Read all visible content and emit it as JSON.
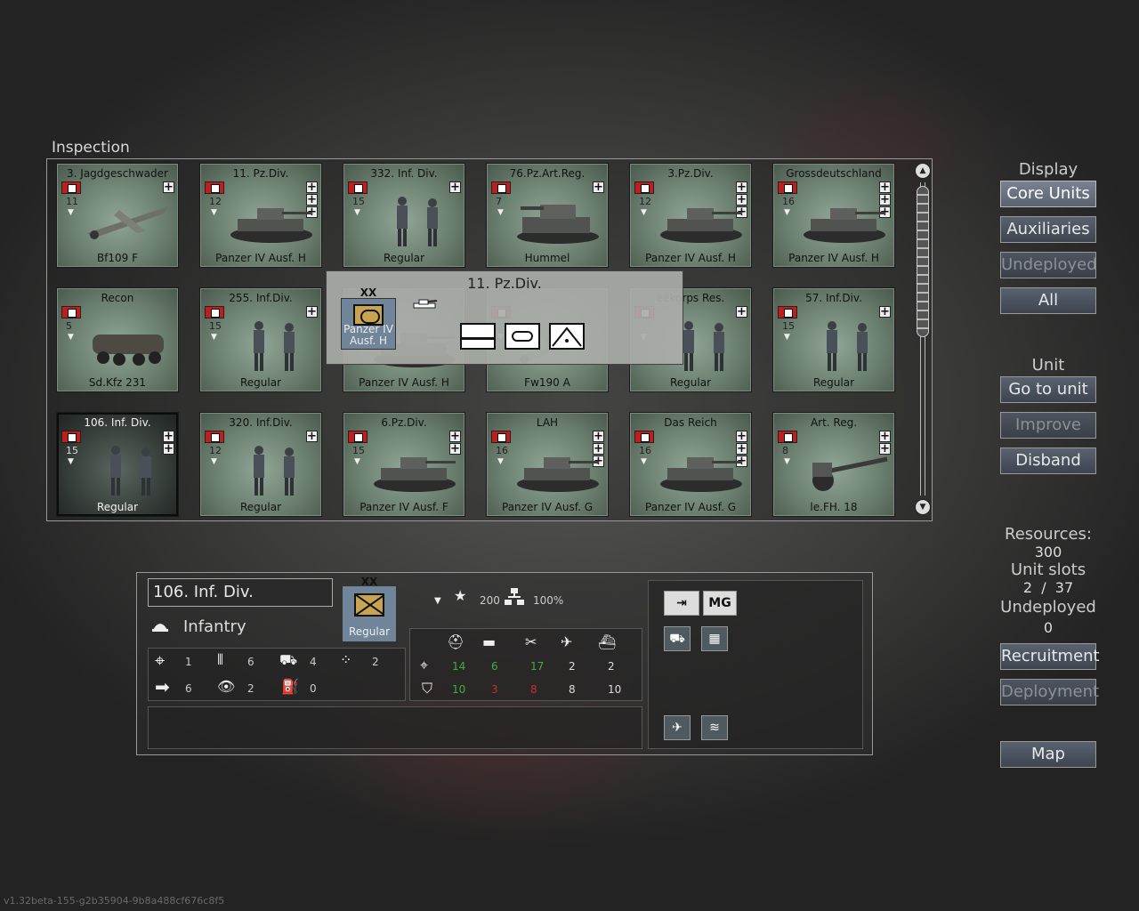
{
  "inspection_label": "Inspection",
  "units": [
    {
      "name": "3. Jagdgeschwader",
      "type": "Bf109 F",
      "strength": "11",
      "plus_count": 1,
      "kind": "plane"
    },
    {
      "name": "11. Pz.Div.",
      "type": "Panzer IV Ausf. H",
      "strength": "12",
      "plus_count": 3,
      "kind": "tank"
    },
    {
      "name": "332. Inf. Div.",
      "type": "Regular",
      "strength": "15",
      "plus_count": 1,
      "kind": "infantry"
    },
    {
      "name": "76.Pz.Art.Reg.",
      "type": "Hummel",
      "strength": "7",
      "plus_count": 1,
      "kind": "artillery-tank"
    },
    {
      "name": "3.Pz.Div.",
      "type": "Panzer IV Ausf. H",
      "strength": "12",
      "plus_count": 3,
      "kind": "tank"
    },
    {
      "name": "Grossdeutschland",
      "type": "Panzer IV Ausf. H",
      "strength": "16",
      "plus_count": 3,
      "kind": "tank"
    },
    {
      "name": "Recon",
      "type": "Sd.Kfz 231",
      "strength": "5",
      "plus_count": 0,
      "kind": "armored-car"
    },
    {
      "name": "255. Inf.Div.",
      "type": "Regular",
      "strength": "15",
      "plus_count": 1,
      "kind": "infantry"
    },
    {
      "name": "",
      "type": "Panzer IV Ausf. H",
      "strength": "",
      "plus_count": 0,
      "kind": "tank"
    },
    {
      "name": "",
      "type": "Fw190 A",
      "strength": "",
      "plus_count": 0,
      "kind": "plane"
    },
    {
      "name": "eekorps Res.",
      "type": "Regular",
      "strength": "",
      "plus_count": 1,
      "kind": "infantry"
    },
    {
      "name": "57. Inf.Div.",
      "type": "Regular",
      "strength": "15",
      "plus_count": 1,
      "kind": "infantry"
    },
    {
      "name": "106. Inf. Div.",
      "type": "Regular",
      "strength": "15",
      "plus_count": 2,
      "kind": "infantry",
      "selected": true
    },
    {
      "name": "320. Inf.Div.",
      "type": "Regular",
      "strength": "12",
      "plus_count": 1,
      "kind": "infantry"
    },
    {
      "name": "6.Pz.Div.",
      "type": "Panzer IV Ausf. F",
      "strength": "15",
      "plus_count": 2,
      "kind": "tank"
    },
    {
      "name": "LAH",
      "type": "Panzer IV Ausf. G",
      "strength": "16",
      "plus_count": 3,
      "kind": "tank"
    },
    {
      "name": "Das Reich",
      "type": "Panzer IV Ausf. G",
      "strength": "16",
      "plus_count": 3,
      "kind": "tank"
    },
    {
      "name": "Art. Reg.",
      "type": "le.FH. 18",
      "strength": "8",
      "plus_count": 2,
      "kind": "gun"
    }
  ],
  "tooltip": {
    "title": "11. Pz.Div.",
    "echelon": "XX",
    "counter_label": "Panzer IV Ausf. H"
  },
  "menu": {
    "display_label": "Display",
    "core_units": "Core Units",
    "auxiliaries": "Auxiliaries",
    "undeployed": "Undeployed",
    "all": "All",
    "unit_label": "Unit",
    "go_to_unit": "Go to unit",
    "improve": "Improve",
    "disband": "Disband",
    "resources_label": "Resources:",
    "resources_value": "300",
    "unit_slots_label": "Unit slots",
    "unit_slots_used": "2",
    "unit_slots_sep": "/",
    "unit_slots_total": "37",
    "undeployed_label": "Undeployed",
    "undeployed_value": "0",
    "recruitment": "Recruitment",
    "deployment": "Deployment",
    "map": "Map"
  },
  "detail": {
    "name": "106. Inf. Div.",
    "class": "Infantry",
    "echelon": "XX",
    "counter_label": "Regular",
    "experience": "200",
    "supply": "100%",
    "stats": {
      "spotting_range": "1",
      "ammo": "6",
      "transport": "4",
      "initiative": "2",
      "movement": "6",
      "vision": "2",
      "fuel": "0"
    },
    "attack": [
      "14",
      "6",
      "17",
      "2",
      "2"
    ],
    "defense": [
      "10",
      "3",
      "8",
      "8",
      "10"
    ],
    "mg_label": "MG"
  },
  "version": "v1.32beta-155-g2b35904-9b8a488cf676c8f5",
  "colors": {
    "green": "#3fae3f",
    "red": "#c03030",
    "counter_blue": "#70849a",
    "armor_symbol": "#c8a452"
  }
}
